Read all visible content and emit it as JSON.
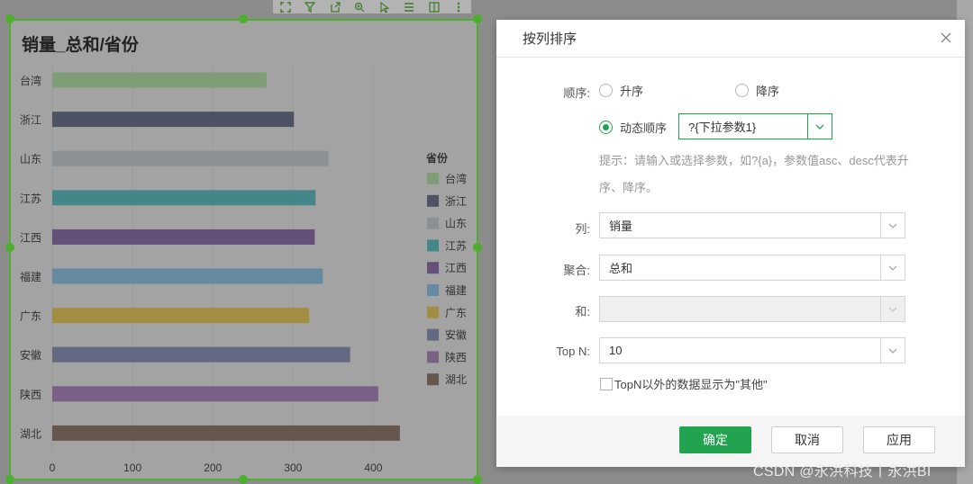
{
  "chart_panel": {
    "title": "销量_总和/省份",
    "toolbar_icons": [
      "expand-icon",
      "filter-icon",
      "export-icon",
      "zoom-icon",
      "select-icon",
      "list-icon",
      "layout-icon",
      "more-icon"
    ]
  },
  "chart_data": {
    "type": "bar",
    "orientation": "horizontal",
    "title": "销量_总和/省份",
    "categories": [
      "台湾",
      "浙江",
      "山东",
      "江苏",
      "江西",
      "福建",
      "广东",
      "安徽",
      "陕西",
      "湖北"
    ],
    "values": [
      267,
      301,
      344,
      328,
      327,
      337,
      320,
      371,
      406,
      433
    ],
    "colors": [
      "#77a96a",
      "#27304a",
      "#8e9296",
      "#1a8386",
      "#4c2b6b",
      "#4f88ae",
      "#b08f14",
      "#495478",
      "#6e4681",
      "#4d3628"
    ],
    "xlim": [
      0,
      450
    ],
    "xticks": [
      0,
      100,
      200,
      300,
      400
    ],
    "legend": {
      "title": "省份",
      "position": "right",
      "items": [
        "台湾",
        "浙江",
        "山东",
        "江苏",
        "江西",
        "福建",
        "广东",
        "安徽",
        "陕西",
        "湖北"
      ]
    },
    "grid": "vertical"
  },
  "dialog": {
    "title": "按列排序",
    "order_label": "顺序:",
    "asc_label": "升序",
    "desc_label": "降序",
    "dynamic_label": "动态顺序",
    "dynamic_value": "?{下拉参数1}",
    "hint": "提示：请输入或选择参数，如?{a}，参数值asc、desc代表升序、降序。",
    "column_label": "列:",
    "column_value": "销量",
    "agg_label": "聚合:",
    "agg_value": "总和",
    "sum_label": "和:",
    "sum_value": "",
    "topn_label": "Top N:",
    "topn_value": "10",
    "topn_other_label": "TopN以外的数据显示为\"其他\"",
    "ok_label": "确定",
    "cancel_label": "取消",
    "apply_label": "应用"
  },
  "watermark": "CSDN @永洪科技丨永洪BI"
}
